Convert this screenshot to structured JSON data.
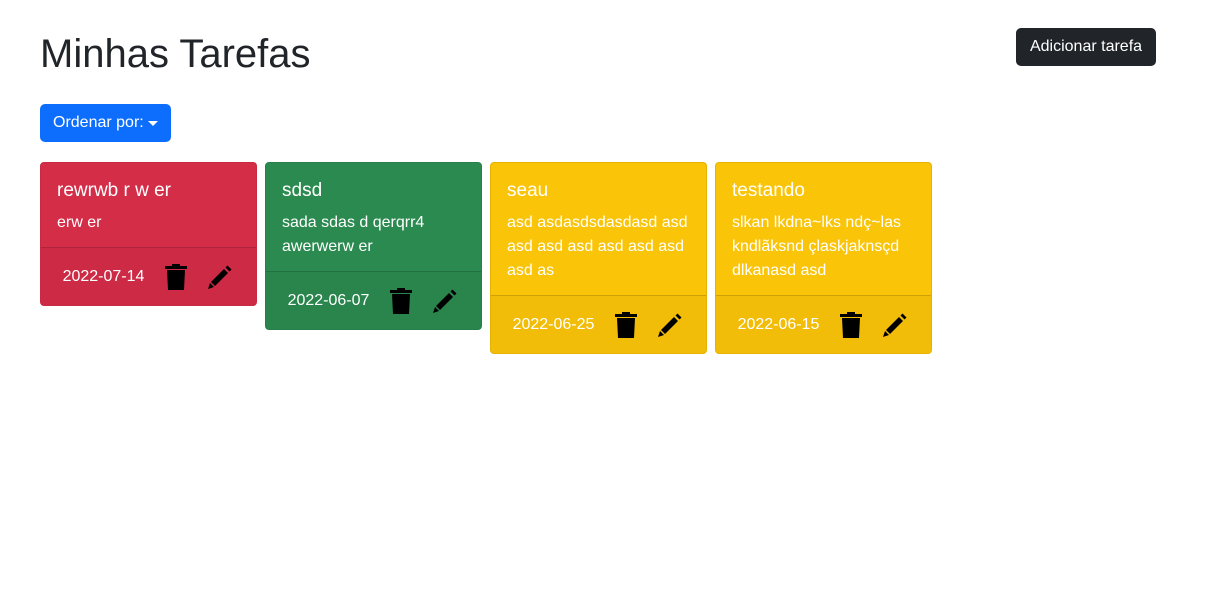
{
  "header": {
    "title": "Minhas Tarefas",
    "add_task_label": "Adicionar tarefa"
  },
  "sort": {
    "label": "Ordenar por:"
  },
  "colors": {
    "danger": "#d42d48",
    "success": "#2b8a4f",
    "warning": "#fac409",
    "primary": "#0d6efd",
    "dark": "#212529"
  },
  "tasks": [
    {
      "title": "rewrwb r w er",
      "description": "erw er",
      "date": "2022-07-14",
      "color": "danger",
      "delete_icon": "trash-icon",
      "edit_icon": "pencil-icon"
    },
    {
      "title": "sdsd",
      "description": "sada sdas d qerqrr4 awerwerw er",
      "date": "2022-06-07",
      "color": "success",
      "delete_icon": "trash-icon",
      "edit_icon": "pencil-icon"
    },
    {
      "title": "seau",
      "description": "asd asdasdsdasdasd asd asd asd asd asd asd asd asd as",
      "date": "2022-06-25",
      "color": "warning",
      "delete_icon": "trash-icon",
      "edit_icon": "pencil-icon"
    },
    {
      "title": "testando",
      "description": "slkan lkdna~lks ndç~las kndlãksnd çlaskjaknsçd dlkanasd asd",
      "date": "2022-06-15",
      "color": "warning",
      "delete_icon": "trash-icon",
      "edit_icon": "pencil-icon"
    }
  ]
}
